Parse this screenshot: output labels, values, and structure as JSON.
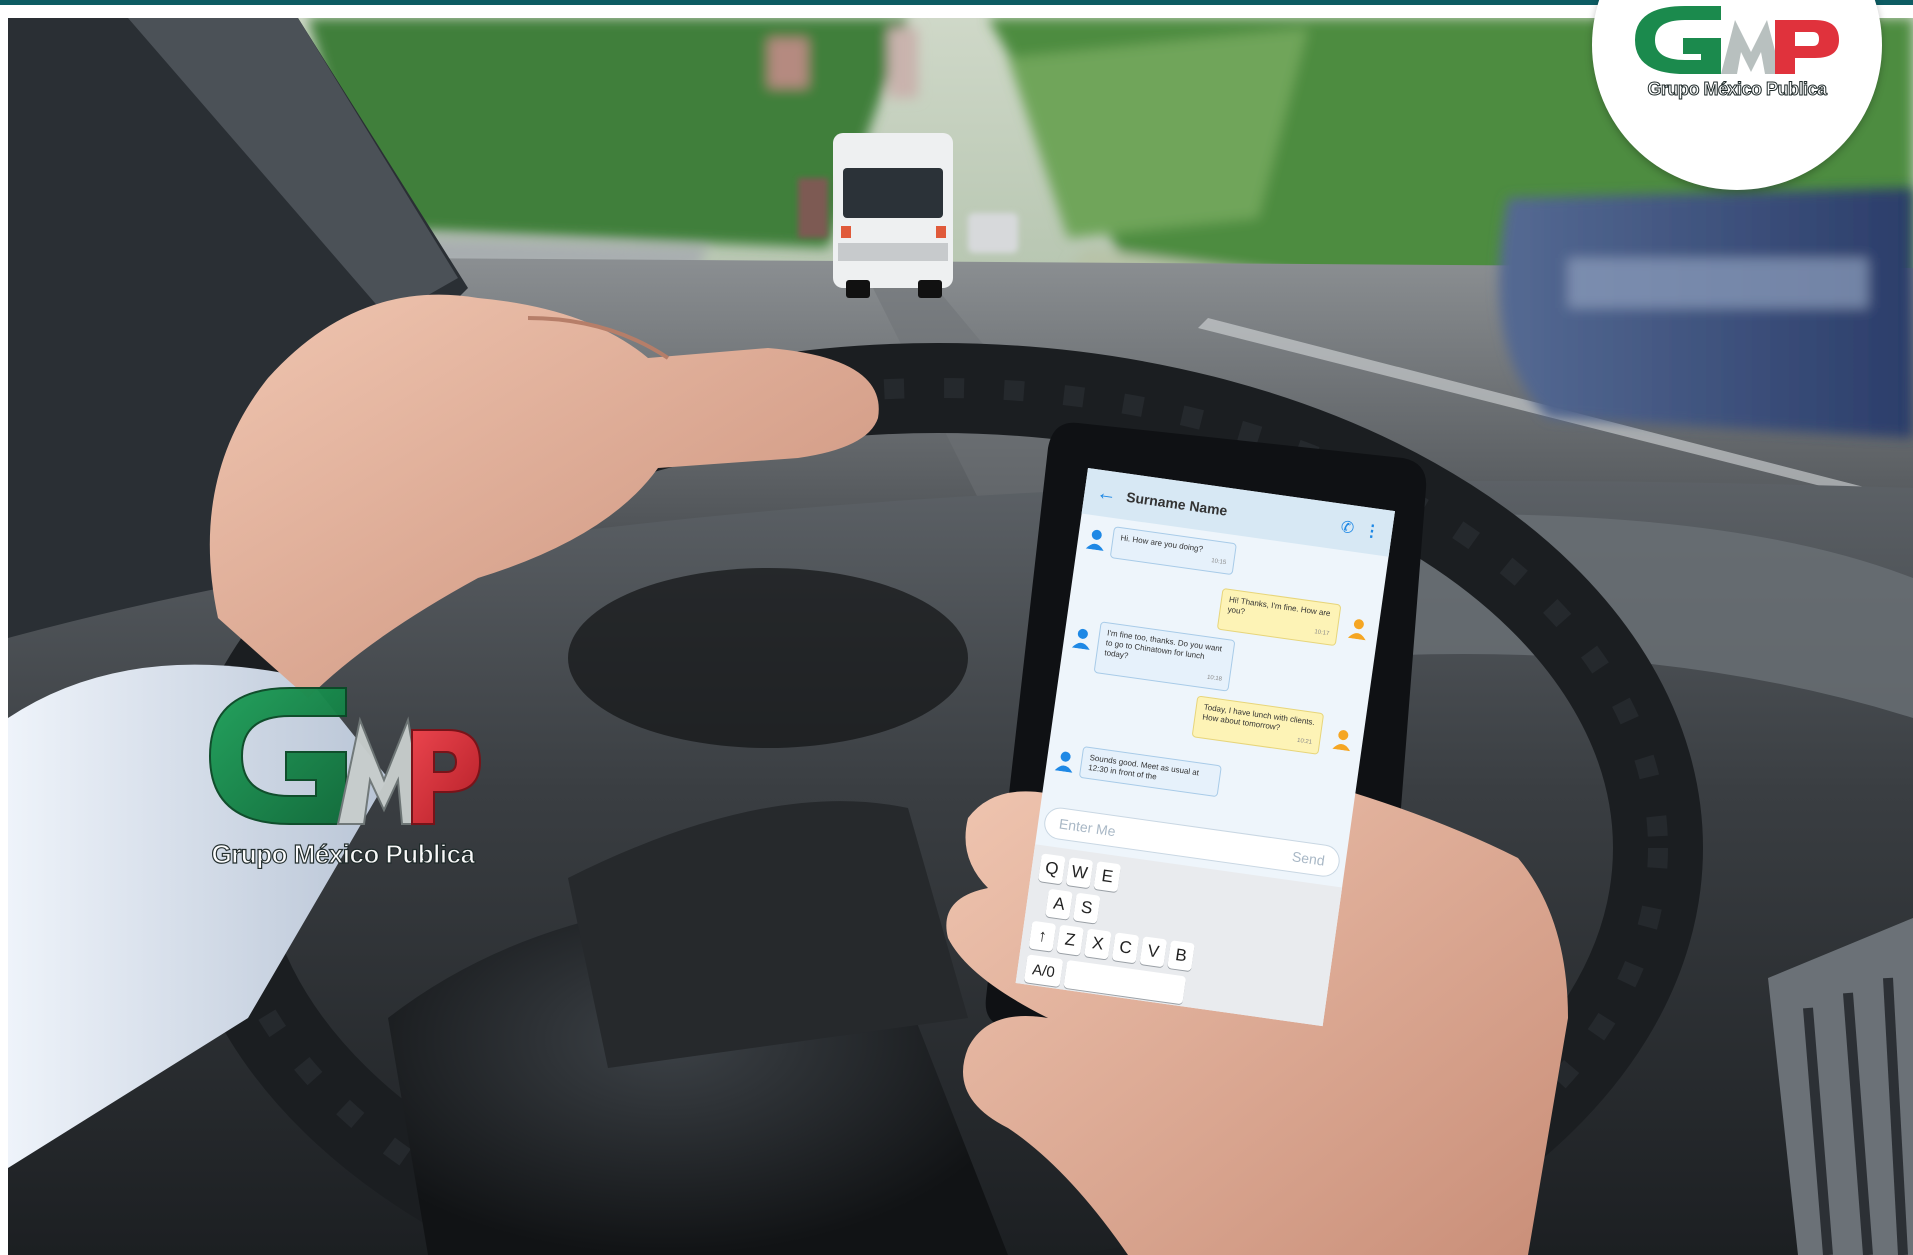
{
  "brand": {
    "logo_monogram": "GMP",
    "logo_caption": "Grupo México Publica",
    "colors": {
      "green": "#1b8a4d",
      "red": "#e0323c",
      "gray": "#9aa3a3",
      "rule": "#0d5c63"
    }
  },
  "corner_logo": {
    "caption": "Grupo México Publica"
  },
  "watermark_logo": {
    "caption": "Grupo México Publica"
  },
  "phone": {
    "contact_name": "Surname Name",
    "header_icons": [
      "back-arrow-icon",
      "phone-call-icon",
      "more-vertical-icon"
    ],
    "messages": [
      {
        "from": "contact",
        "text": "Hi. How are you doing?",
        "time": "10:15"
      },
      {
        "from": "me",
        "text": "Hi! Thanks, I'm fine. How are you?",
        "time": "10:17"
      },
      {
        "from": "contact",
        "text": "I'm fine too, thanks. Do you want to go to Chinatown for lunch today?",
        "time": "10:18"
      },
      {
        "from": "me",
        "text": "Today, I have lunch with clients. How about tomorrow?",
        "time": "10:21"
      },
      {
        "from": "contact",
        "text": "Sounds good. Meet as usual at 12:30 in front of the",
        "time": ""
      }
    ],
    "composer_placeholder": "Enter Me",
    "composer_send": "Send",
    "keyboard_rows": [
      [
        "Q",
        "W",
        "E"
      ],
      [
        "A",
        "S"
      ],
      [
        "↑",
        "Z",
        "X",
        "C",
        "V",
        "B"
      ],
      [
        "A/0"
      ]
    ]
  }
}
